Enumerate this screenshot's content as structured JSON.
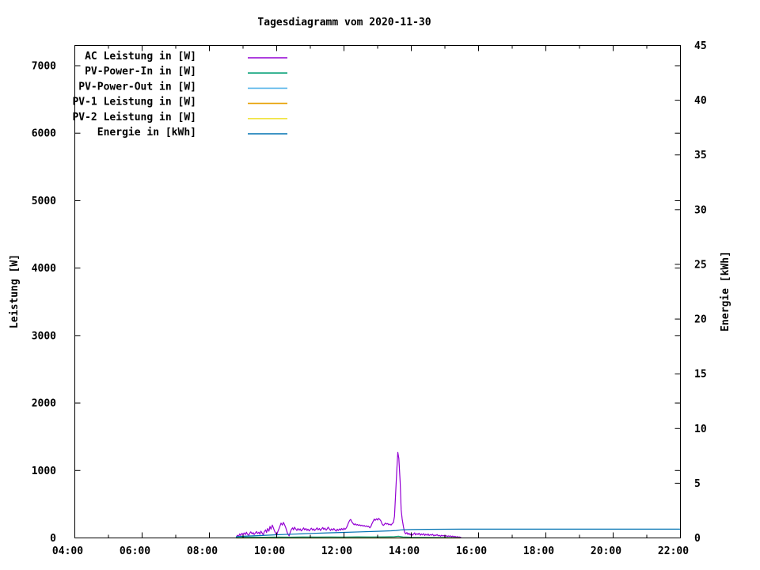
{
  "page": {
    "background": "#ffffff",
    "text_color": "#000000"
  },
  "chart_data": {
    "type": "line",
    "title": "Tagesdiagramm vom 2020-11-30",
    "x_axis": {
      "unit": "time",
      "start_hour": 4,
      "end_hour": 22,
      "major_tick_labels": [
        "04:00",
        "06:00",
        "08:00",
        "10:00",
        "12:00",
        "14:00",
        "16:00",
        "18:00",
        "20:00",
        "22:00"
      ],
      "major_tick_hours": [
        4,
        6,
        8,
        10,
        12,
        14,
        16,
        18,
        20,
        22
      ],
      "minor_tick_hours": [
        5,
        7,
        9,
        11,
        13,
        15,
        17,
        19,
        21
      ]
    },
    "y_axis_left": {
      "label": "Leistung [W]",
      "min": 0,
      "max": 7300,
      "ticks": [
        0,
        1000,
        2000,
        3000,
        4000,
        5000,
        6000,
        7000
      ]
    },
    "y_axis_right": {
      "label": "Energie [kWh]",
      "min": 0,
      "max": 45,
      "ticks": [
        0,
        5,
        10,
        15,
        20,
        25,
        30,
        35,
        40,
        45
      ]
    },
    "legend": {
      "position": "top-left-inside"
    },
    "series": [
      {
        "name": "AC Leistung in [W]",
        "color": "#9400d3",
        "axis": "left",
        "points": [
          [
            8.8,
            8
          ],
          [
            8.83,
            40
          ],
          [
            8.87,
            25
          ],
          [
            8.9,
            60
          ],
          [
            8.93,
            35
          ],
          [
            8.97,
            70
          ],
          [
            9.0,
            45
          ],
          [
            9.03,
            75
          ],
          [
            9.07,
            50
          ],
          [
            9.1,
            85
          ],
          [
            9.13,
            55
          ],
          [
            9.17,
            40
          ],
          [
            9.2,
            70
          ],
          [
            9.23,
            90
          ],
          [
            9.27,
            60
          ],
          [
            9.3,
            80
          ],
          [
            9.33,
            50
          ],
          [
            9.37,
            75
          ],
          [
            9.4,
            95
          ],
          [
            9.43,
            65
          ],
          [
            9.47,
            85
          ],
          [
            9.5,
            55
          ],
          [
            9.53,
            100
          ],
          [
            9.57,
            70
          ],
          [
            9.6,
            45
          ],
          [
            9.63,
            90
          ],
          [
            9.67,
            120
          ],
          [
            9.7,
            80
          ],
          [
            9.73,
            140
          ],
          [
            9.77,
            100
          ],
          [
            9.8,
            170
          ],
          [
            9.83,
            130
          ],
          [
            9.87,
            190
          ],
          [
            9.9,
            150
          ],
          [
            9.93,
            110
          ],
          [
            9.97,
            70
          ],
          [
            10.0,
            40
          ],
          [
            10.03,
            90
          ],
          [
            10.07,
            140
          ],
          [
            10.1,
            180
          ],
          [
            10.13,
            220
          ],
          [
            10.17,
            190
          ],
          [
            10.2,
            230
          ],
          [
            10.23,
            200
          ],
          [
            10.27,
            150
          ],
          [
            10.3,
            100
          ],
          [
            10.33,
            60
          ],
          [
            10.37,
            30
          ],
          [
            10.4,
            80
          ],
          [
            10.43,
            120
          ],
          [
            10.47,
            150
          ],
          [
            10.5,
            120
          ],
          [
            10.53,
            160
          ],
          [
            10.57,
            130
          ],
          [
            10.6,
            110
          ],
          [
            10.63,
            140
          ],
          [
            10.67,
            115
          ],
          [
            10.7,
            135
          ],
          [
            10.73,
            105
          ],
          [
            10.77,
            125
          ],
          [
            10.8,
            150
          ],
          [
            10.83,
            120
          ],
          [
            10.87,
            140
          ],
          [
            10.9,
            110
          ],
          [
            10.93,
            130
          ],
          [
            10.97,
            105
          ],
          [
            11.0,
            125
          ],
          [
            11.03,
            145
          ],
          [
            11.07,
            115
          ],
          [
            11.1,
            135
          ],
          [
            11.13,
            110
          ],
          [
            11.17,
            130
          ],
          [
            11.2,
            150
          ],
          [
            11.23,
            120
          ],
          [
            11.27,
            140
          ],
          [
            11.3,
            110
          ],
          [
            11.33,
            130
          ],
          [
            11.37,
            155
          ],
          [
            11.4,
            125
          ],
          [
            11.43,
            145
          ],
          [
            11.47,
            115
          ],
          [
            11.5,
            135
          ],
          [
            11.53,
            160
          ],
          [
            11.57,
            130
          ],
          [
            11.6,
            110
          ],
          [
            11.63,
            135
          ],
          [
            11.67,
            115
          ],
          [
            11.7,
            140
          ],
          [
            11.73,
            120
          ],
          [
            11.77,
            100
          ],
          [
            11.8,
            130
          ],
          [
            11.83,
            110
          ],
          [
            11.87,
            135
          ],
          [
            11.9,
            115
          ],
          [
            11.93,
            140
          ],
          [
            11.97,
            120
          ],
          [
            12.0,
            145
          ],
          [
            12.03,
            125
          ],
          [
            12.07,
            150
          ],
          [
            12.1,
            180
          ],
          [
            12.13,
            220
          ],
          [
            12.17,
            260
          ],
          [
            12.2,
            275
          ],
          [
            12.23,
            240
          ],
          [
            12.27,
            215
          ],
          [
            12.3,
            195
          ],
          [
            12.33,
            210
          ],
          [
            12.37,
            190
          ],
          [
            12.4,
            200
          ],
          [
            12.43,
            185
          ],
          [
            12.47,
            195
          ],
          [
            12.5,
            180
          ],
          [
            12.53,
            190
          ],
          [
            12.57,
            175
          ],
          [
            12.6,
            185
          ],
          [
            12.63,
            170
          ],
          [
            12.67,
            180
          ],
          [
            12.7,
            165
          ],
          [
            12.73,
            175
          ],
          [
            12.77,
            150
          ],
          [
            12.8,
            170
          ],
          [
            12.83,
            210
          ],
          [
            12.87,
            250
          ],
          [
            12.9,
            280
          ],
          [
            12.93,
            260
          ],
          [
            12.97,
            285
          ],
          [
            13.0,
            265
          ],
          [
            13.03,
            290
          ],
          [
            13.07,
            270
          ],
          [
            13.1,
            250
          ],
          [
            13.13,
            210
          ],
          [
            13.17,
            185
          ],
          [
            13.2,
            200
          ],
          [
            13.23,
            220
          ],
          [
            13.27,
            205
          ],
          [
            13.3,
            215
          ],
          [
            13.33,
            195
          ],
          [
            13.37,
            205
          ],
          [
            13.4,
            190
          ],
          [
            13.43,
            210
          ],
          [
            13.47,
            230
          ],
          [
            13.5,
            320
          ],
          [
            13.53,
            600
          ],
          [
            13.57,
            1000
          ],
          [
            13.6,
            1270
          ],
          [
            13.63,
            1180
          ],
          [
            13.67,
            820
          ],
          [
            13.7,
            420
          ],
          [
            13.73,
            280
          ],
          [
            13.77,
            160
          ],
          [
            13.8,
            90
          ],
          [
            13.83,
            60
          ],
          [
            13.87,
            80
          ],
          [
            13.9,
            50
          ],
          [
            13.93,
            70
          ],
          [
            13.97,
            45
          ],
          [
            14.0,
            65
          ],
          [
            14.03,
            40
          ],
          [
            14.07,
            60
          ],
          [
            14.1,
            75
          ],
          [
            14.13,
            45
          ],
          [
            14.17,
            65
          ],
          [
            14.2,
            50
          ],
          [
            14.23,
            70
          ],
          [
            14.27,
            40
          ],
          [
            14.3,
            60
          ],
          [
            14.33,
            45
          ],
          [
            14.37,
            65
          ],
          [
            14.4,
            35
          ],
          [
            14.43,
            55
          ],
          [
            14.47,
            40
          ],
          [
            14.5,
            60
          ],
          [
            14.53,
            35
          ],
          [
            14.57,
            50
          ],
          [
            14.6,
            40
          ],
          [
            14.63,
            55
          ],
          [
            14.67,
            30
          ],
          [
            14.7,
            45
          ],
          [
            14.73,
            35
          ],
          [
            14.77,
            50
          ],
          [
            14.8,
            30
          ],
          [
            14.83,
            40
          ],
          [
            14.87,
            25
          ],
          [
            14.9,
            40
          ],
          [
            14.93,
            30
          ],
          [
            14.97,
            35
          ],
          [
            15.0,
            25
          ],
          [
            15.03,
            35
          ],
          [
            15.07,
            20
          ],
          [
            15.1,
            30
          ],
          [
            15.13,
            25
          ],
          [
            15.17,
            30
          ],
          [
            15.2,
            18
          ],
          [
            15.23,
            28
          ],
          [
            15.27,
            15
          ],
          [
            15.3,
            25
          ],
          [
            15.33,
            12
          ],
          [
            15.37,
            20
          ],
          [
            15.4,
            10
          ],
          [
            15.43,
            15
          ],
          [
            15.47,
            8
          ]
        ]
      },
      {
        "name": "PV-Power-In in [W]",
        "color": "#009e73",
        "axis": "left",
        "points": [
          [
            8.8,
            5
          ],
          [
            9.0,
            10
          ],
          [
            9.3,
            12
          ],
          [
            9.6,
            10
          ],
          [
            10.0,
            14
          ],
          [
            10.4,
            12
          ],
          [
            10.8,
            15
          ],
          [
            11.2,
            13
          ],
          [
            11.6,
            15
          ],
          [
            12.0,
            14
          ],
          [
            12.4,
            16
          ],
          [
            12.8,
            15
          ],
          [
            13.2,
            17
          ],
          [
            13.5,
            20
          ],
          [
            13.62,
            26
          ],
          [
            13.75,
            15
          ],
          [
            14.0,
            10
          ],
          [
            14.4,
            9
          ],
          [
            14.8,
            8
          ],
          [
            15.2,
            6
          ],
          [
            15.45,
            4
          ]
        ]
      },
      {
        "name": "PV-Power-Out in [W]",
        "color": "#56b4e9",
        "axis": "left",
        "points": [
          [
            8.8,
            0
          ],
          [
            15.45,
            0
          ]
        ]
      },
      {
        "name": "PV-1 Leistung in [W]",
        "color": "#e69f00",
        "axis": "left",
        "points": [
          [
            8.8,
            0
          ],
          [
            15.45,
            0
          ]
        ]
      },
      {
        "name": "PV-2 Leistung in [W]",
        "color": "#f0e442",
        "axis": "left",
        "points": [
          [
            8.8,
            0
          ],
          [
            15.45,
            0
          ]
        ]
      },
      {
        "name": "Energie in [kWh]",
        "color": "#0072b2",
        "axis": "right",
        "points": [
          [
            8.8,
            0.11
          ],
          [
            9.0,
            0.15
          ],
          [
            9.5,
            0.22
          ],
          [
            10.0,
            0.29
          ],
          [
            10.5,
            0.35
          ],
          [
            11.0,
            0.41
          ],
          [
            11.5,
            0.46
          ],
          [
            12.0,
            0.51
          ],
          [
            12.5,
            0.56
          ],
          [
            13.0,
            0.61
          ],
          [
            13.4,
            0.65
          ],
          [
            13.55,
            0.68
          ],
          [
            13.7,
            0.74
          ],
          [
            14.0,
            0.77
          ],
          [
            14.5,
            0.79
          ],
          [
            15.5,
            0.8
          ],
          [
            22.0,
            0.8
          ]
        ]
      }
    ]
  }
}
